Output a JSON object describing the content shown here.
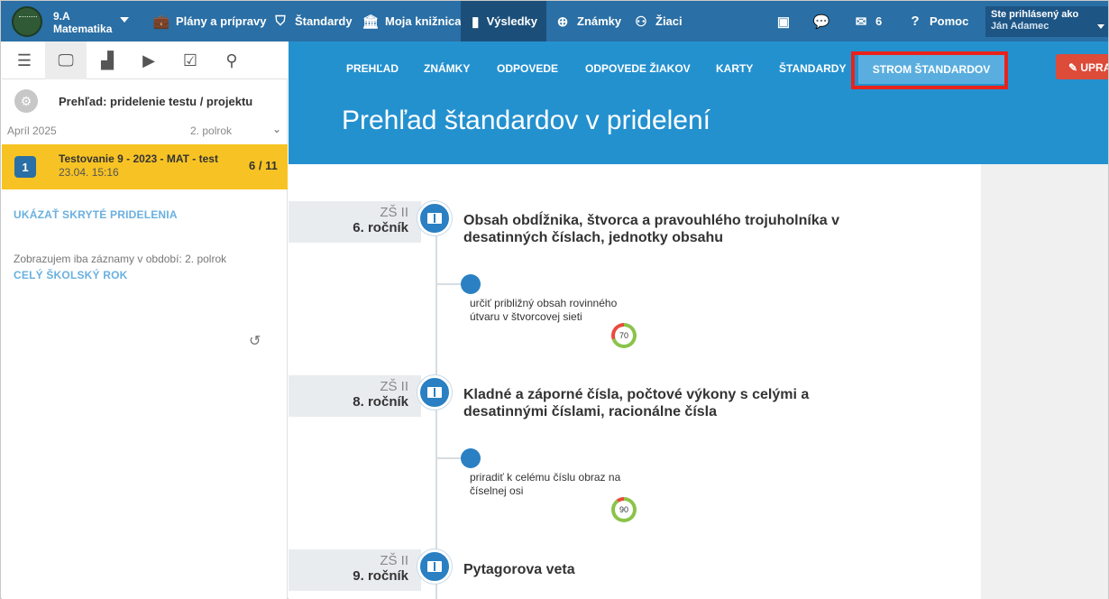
{
  "topbar": {
    "class_code": "9.A",
    "class_subject": "Matematika",
    "nav": [
      {
        "label": "Plány a prípravy",
        "icon": "briefcase-icon",
        "glyph": "💼"
      },
      {
        "label": "Štandardy",
        "icon": "shield-icon",
        "glyph": "⛉"
      },
      {
        "label": "Moja knižnica",
        "icon": "library-icon",
        "glyph": "🏛"
      },
      {
        "label": "Výsledky",
        "icon": "bar-chart-icon",
        "glyph": "▮"
      },
      {
        "label": "Známky",
        "icon": "grades-icon",
        "glyph": "⊕"
      },
      {
        "label": "Žiaci",
        "icon": "students-icon",
        "glyph": "⚇"
      }
    ],
    "cast_icon": "cast-icon",
    "chat_icon": "chat-icon",
    "mail_count": "6",
    "help_label": "Pomoc",
    "login_label": "Ste prihlásený ako",
    "user_name": "Ján Adamec"
  },
  "sidebar": {
    "assignment_title": "Prehľad: pridelenie testu / projektu",
    "month": "Apríl 2025",
    "semester": "2. polrok",
    "test": {
      "number": "1",
      "name": "Testovanie 9 - 2023 - MAT - test",
      "date": "23.04. 15:16",
      "score": "6 / 11"
    },
    "show_hidden_link": "UKÁZAŤ SKRYTÉ PRIDELENIA",
    "filter_text": "Zobrazujem iba záznamy v období: 2. polrok",
    "whole_year_link": "CELÝ ŠKOLSKÝ ROK"
  },
  "main": {
    "tabs": [
      "PREHĽAD",
      "ZNÁMKY",
      "ODPOVEDE",
      "ODPOVEDE ŽIAKOV",
      "KARTY",
      "ŠTANDARDY"
    ],
    "active_tab": "STROM ŠTANDARDOV",
    "edit_label": "UPRAVIŤ",
    "page_title": "Prehľad štandardov v pridelení",
    "standards": [
      {
        "level": "ZŠ II",
        "grade": "6. ročník",
        "title": "Obsah obdĺžnika, štvorca a pravouhlého trojuholníka v desatinných číslach, jednotky obsahu",
        "sub": {
          "text": "určiť približný obsah rovinného útvaru v štvorcovej sieti",
          "score": 70
        }
      },
      {
        "level": "ZŠ II",
        "grade": "8. ročník",
        "title": "Kladné a záporné čísla, počtové výkony s celými a desatinnými číslami, racionálne čísla",
        "sub": {
          "text": "priradiť k celému číslu obraz na číselnej osi",
          "score": 90
        }
      },
      {
        "level": "ZŠ II",
        "grade": "9. ročník",
        "title": "Pytagorova veta"
      }
    ]
  },
  "colors": {
    "topbar": "#2a6fa5",
    "header_blue": "#2491cf",
    "active_card": "#f7c324",
    "highlight": "#e8221b",
    "edit_button": "#dd4b39"
  }
}
